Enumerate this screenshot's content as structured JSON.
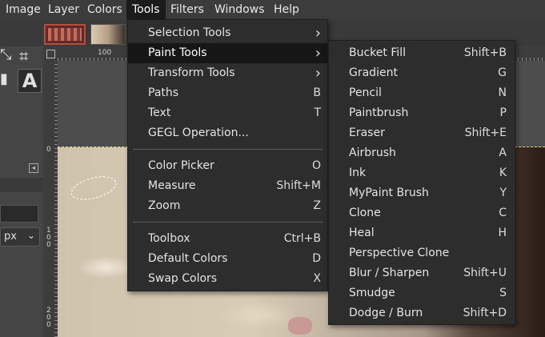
{
  "menubar": {
    "items": [
      "Image",
      "Layer",
      "Colors",
      "Tools",
      "Filters",
      "Windows",
      "Help"
    ],
    "active": "Tools"
  },
  "toolbox": {
    "unit": "px"
  },
  "rulers": {
    "h_label": "100",
    "v_labels": [
      "0",
      "100",
      "200"
    ]
  },
  "tools_menu": {
    "groups": [
      [
        {
          "label": "Selection Tools",
          "submenu": true
        },
        {
          "label": "Paint Tools",
          "submenu": true,
          "highlighted": true
        },
        {
          "label": "Transform Tools",
          "submenu": true
        },
        {
          "label": "Paths",
          "shortcut": "B"
        },
        {
          "label": "Text",
          "shortcut": "T"
        },
        {
          "label": "GEGL Operation..."
        }
      ],
      [
        {
          "label": "Color Picker",
          "shortcut": "O"
        },
        {
          "label": "Measure",
          "shortcut": "Shift+M"
        },
        {
          "label": "Zoom",
          "shortcut": "Z"
        }
      ],
      [
        {
          "label": "Toolbox",
          "shortcut": "Ctrl+B"
        },
        {
          "label": "Default Colors",
          "shortcut": "D"
        },
        {
          "label": "Swap Colors",
          "shortcut": "X"
        }
      ]
    ]
  },
  "paint_tools_menu": {
    "items": [
      {
        "label": "Bucket Fill",
        "shortcut": "Shift+B"
      },
      {
        "label": "Gradient",
        "shortcut": "G"
      },
      {
        "label": "Pencil",
        "shortcut": "N"
      },
      {
        "label": "Paintbrush",
        "shortcut": "P"
      },
      {
        "label": "Eraser",
        "shortcut": "Shift+E"
      },
      {
        "label": "Airbrush",
        "shortcut": "A"
      },
      {
        "label": "Ink",
        "shortcut": "K"
      },
      {
        "label": "MyPaint Brush",
        "shortcut": "Y"
      },
      {
        "label": "Clone",
        "shortcut": "C"
      },
      {
        "label": "Heal",
        "shortcut": "H"
      },
      {
        "label": "Perspective Clone",
        "shortcut": ""
      },
      {
        "label": "Blur / Sharpen",
        "shortcut": "Shift+U"
      },
      {
        "label": "Smudge",
        "shortcut": "S"
      },
      {
        "label": "Dodge / Burn",
        "shortcut": "Shift+D"
      }
    ]
  },
  "colors": {
    "menu_bg": "#2d2d2d",
    "menu_highlight": "#161616",
    "menubar_bg": "#3c3c3c"
  }
}
